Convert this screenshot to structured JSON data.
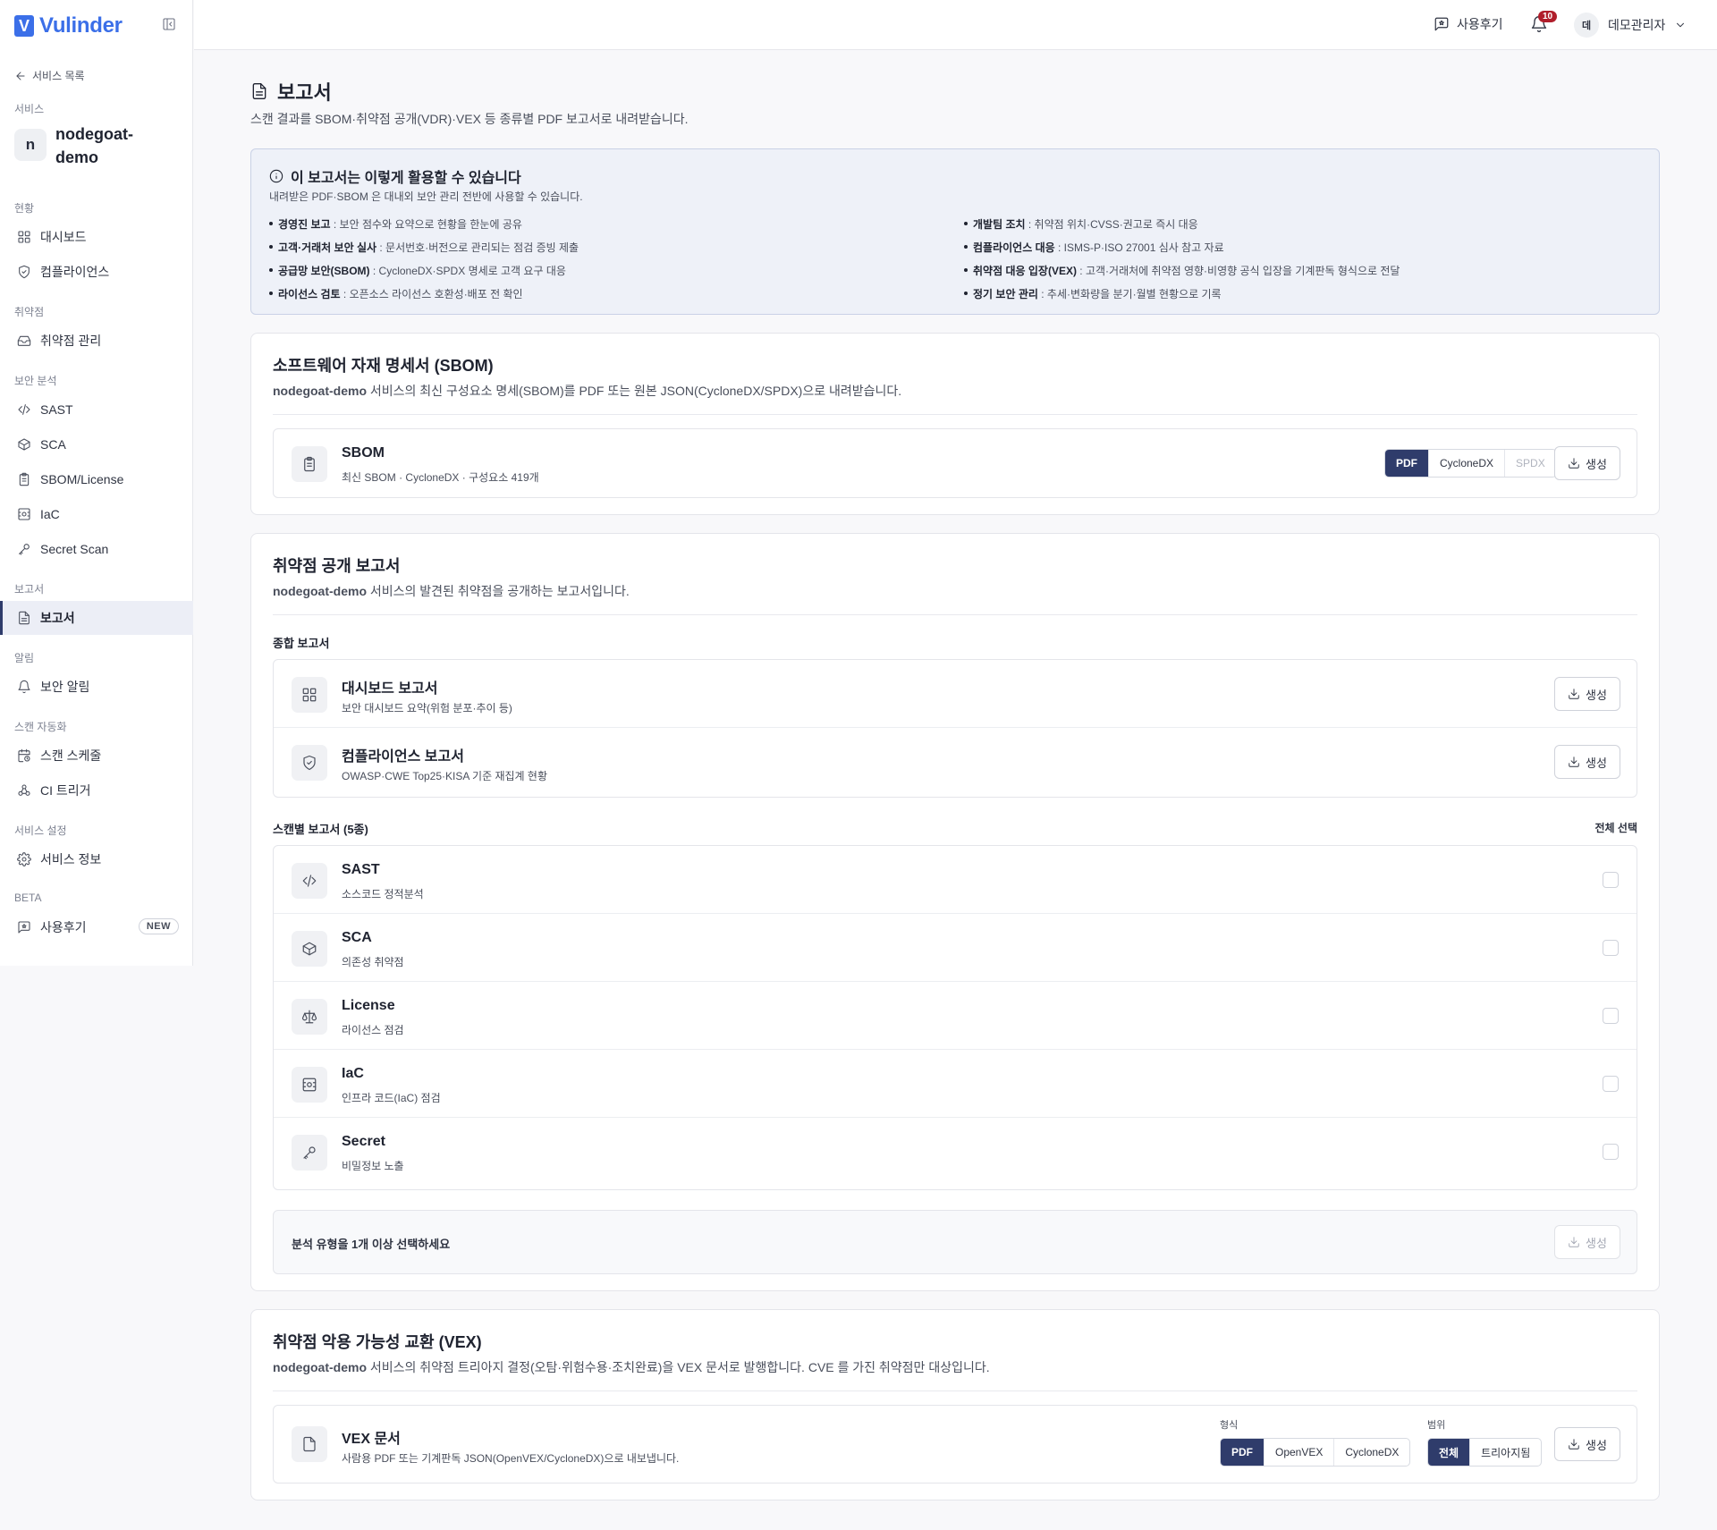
{
  "app": {
    "name": "Vulinder",
    "logo_letter": "V"
  },
  "sidebar": {
    "back_label": "서비스 목록",
    "service_section": "서비스",
    "service_initial": "n",
    "service_name": "nodegoat-demo",
    "sections": [
      {
        "label": "현황",
        "items": [
          {
            "label": "대시보드",
            "icon": "dashboard-icon"
          },
          {
            "label": "컴플라이언스",
            "icon": "shield-icon"
          }
        ]
      },
      {
        "label": "취약점",
        "items": [
          {
            "label": "취약점 관리",
            "icon": "inbox-icon"
          }
        ]
      },
      {
        "label": "보안 분석",
        "items": [
          {
            "label": "SAST",
            "icon": "code-icon"
          },
          {
            "label": "SCA",
            "icon": "package-icon"
          },
          {
            "label": "SBOM/License",
            "icon": "clipboard-icon"
          },
          {
            "label": "IaC",
            "icon": "iac-icon"
          },
          {
            "label": "Secret Scan",
            "icon": "key-icon"
          }
        ]
      },
      {
        "label": "보고서",
        "items": [
          {
            "label": "보고서",
            "icon": "report-icon",
            "active": true
          }
        ]
      },
      {
        "label": "알림",
        "items": [
          {
            "label": "보안 알림",
            "icon": "bell-icon"
          }
        ]
      },
      {
        "label": "스캔 자동화",
        "items": [
          {
            "label": "스캔 스케줄",
            "icon": "calendar-clock-icon"
          },
          {
            "label": "CI 트리거",
            "icon": "webhook-icon"
          }
        ]
      },
      {
        "label": "서비스 설정",
        "items": [
          {
            "label": "서비스 정보",
            "icon": "gear-icon"
          }
        ]
      },
      {
        "label": "BETA",
        "items": [
          {
            "label": "사용후기",
            "icon": "feedback-icon",
            "badge": "NEW"
          }
        ]
      }
    ]
  },
  "topbar": {
    "feedback_label": "사용후기",
    "notification_count": "10",
    "user_initial": "데",
    "user_name": "데모관리자"
  },
  "page": {
    "title": "보고서",
    "description": "스캔 결과를 SBOM·취약점 공개(VDR)·VEX 등 종류별 PDF 보고서로 내려받습니다."
  },
  "info": {
    "title": "이 보고서는 이렇게 활용할 수 있습니다",
    "subtitle": "내려받은 PDF·SBOM 은 대내외 보안 관리 전반에 사용할 수 있습니다.",
    "left": [
      {
        "term": "경영진 보고",
        "desc": " : 보안 점수와 요약으로 현황을 한눈에 공유"
      },
      {
        "term": "고객·거래처 보안 실사",
        "desc": " : 문서번호·버전으로 관리되는 점검 증빙 제출"
      },
      {
        "term": "공급망 보안(SBOM)",
        "desc": " : CycloneDX·SPDX 명세로 고객 요구 대응"
      },
      {
        "term": "라이선스 검토",
        "desc": " : 오픈소스 라이선스 호환성·배포 전 확인"
      }
    ],
    "right": [
      {
        "term": "개발팀 조치",
        "desc": " : 취약점 위치·CVSS·권고로 즉시 대응"
      },
      {
        "term": "컴플라이언스 대응",
        "desc": " : ISMS-P·ISO 27001 심사 참고 자료"
      },
      {
        "term": "취약점 대응 입장(VEX)",
        "desc": " : 고객·거래처에 취약점 영향·비영향 공식 입장을 기계판독 형식으로 전달"
      },
      {
        "term": "정기 보안 관리",
        "desc": " : 추세·변화량을 분기·월별 현황으로 기록"
      }
    ]
  },
  "sbom": {
    "title": "소프트웨어 자재 명세서 (SBOM)",
    "desc_service": "nodegoat-demo",
    "desc_text": " 서비스의 최신 구성요소 명세(SBOM)를 PDF 또는 원본 JSON(CycloneDX/SPDX)으로 내려받습니다.",
    "item_title": "SBOM",
    "item_sub": "최신 SBOM · CycloneDX · 구성요소 419개",
    "formats": [
      "PDF",
      "CycloneDX",
      "SPDX"
    ],
    "selected_format": "PDF",
    "generate_label": "생성"
  },
  "vdr": {
    "title": "취약점 공개 보고서",
    "desc_service": "nodegoat-demo",
    "desc_text": " 서비스의 발견된 취약점을 공개하는 보고서입니다.",
    "summary_heading": "종합 보고서",
    "summary_items": [
      {
        "title": "대시보드 보고서",
        "sub": "보안 대시보드 요약(위험 분포·추이 등)",
        "icon": "dashboard-icon"
      },
      {
        "title": "컴플라이언스 보고서",
        "sub": "OWASP·CWE Top25·KISA 기준 재집계 현황",
        "icon": "shield-icon"
      }
    ],
    "scan_heading": "스캔별 보고서 (5종)",
    "select_all_label": "전체 선택",
    "scan_items": [
      {
        "title": "SAST",
        "sub": "소스코드 정적분석",
        "icon": "code-icon"
      },
      {
        "title": "SCA",
        "sub": "의존성 취약점",
        "icon": "package-icon"
      },
      {
        "title": "License",
        "sub": "라이선스 점검",
        "icon": "scale-icon"
      },
      {
        "title": "IaC",
        "sub": "인프라 코드(IaC) 점검",
        "icon": "iac-icon"
      },
      {
        "title": "Secret",
        "sub": "비밀정보 노출",
        "icon": "key-icon"
      }
    ],
    "footer_hint": "분석 유형을 1개 이상 선택하세요",
    "generate_label": "생성"
  },
  "vex": {
    "title": "취약점 악용 가능성 교환 (VEX)",
    "desc_service": "nodegoat-demo",
    "desc_text": " 서비스의 취약점 트리아지 결정(오탐·위험수용·조치완료)을 VEX 문서로 발행합니다. CVE 를 가진 취약점만 대상입니다.",
    "item_title": "VEX 문서",
    "item_sub": "사람용 PDF 또는 기계판독 JSON(OpenVEX/CycloneDX)으로 내보냅니다.",
    "format_label": "형식",
    "formats": [
      "PDF",
      "OpenVEX",
      "CycloneDX"
    ],
    "scope_label": "범위",
    "scopes": [
      "전체",
      "트리아지됨"
    ],
    "generate_label": "생성"
  }
}
